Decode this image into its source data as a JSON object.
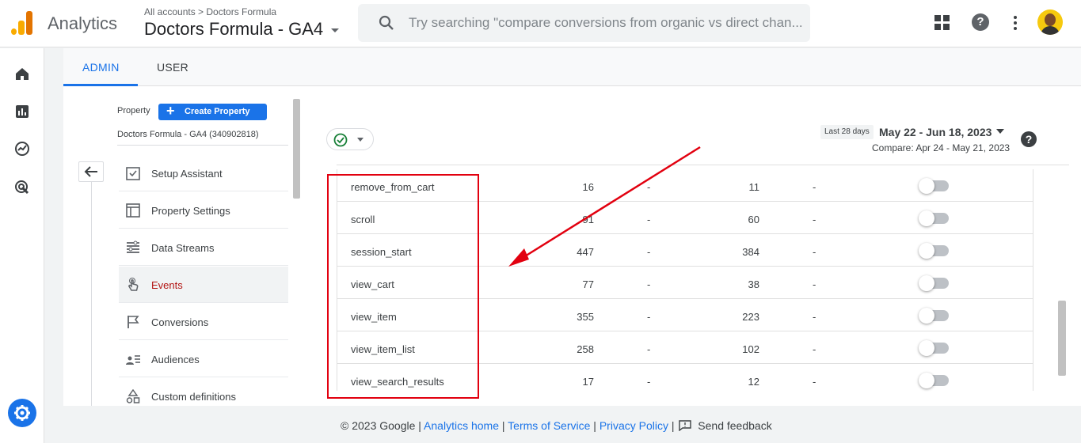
{
  "header": {
    "app_name": "Analytics",
    "breadcrumb": "All accounts > Doctors Formula",
    "property_title": "Doctors Formula - GA4",
    "search_placeholder": "Try searching \"compare conversions from organic vs direct chan..."
  },
  "tabs": [
    {
      "label": "ADMIN",
      "active": true
    },
    {
      "label": "USER",
      "active": false
    }
  ],
  "property_panel": {
    "label": "Property",
    "create_button": "Create Property",
    "property_name": "Doctors Formula - GA4 (340902818)"
  },
  "menu": [
    {
      "label": "Setup Assistant",
      "icon": "checklist-icon"
    },
    {
      "label": "Property Settings",
      "icon": "settings-panel-icon"
    },
    {
      "label": "Data Streams",
      "icon": "data-streams-icon"
    },
    {
      "label": "Events",
      "icon": "touch-icon",
      "active": true
    },
    {
      "label": "Conversions",
      "icon": "flag-icon"
    },
    {
      "label": "Audiences",
      "icon": "audience-icon"
    },
    {
      "label": "Custom definitions",
      "icon": "shapes-icon"
    }
  ],
  "date": {
    "badge": "Last 28 days",
    "range": "May 22 - Jun 18, 2023",
    "compare": "Compare: Apr 24 - May 21, 2023"
  },
  "events": [
    {
      "name": "remove_from_cart",
      "count": "16",
      "change": "-",
      "users": "11",
      "users_change": "-",
      "conversion": false
    },
    {
      "name": "scroll",
      "count": "91",
      "change": "-",
      "users": "60",
      "users_change": "-",
      "conversion": false
    },
    {
      "name": "session_start",
      "count": "447",
      "change": "-",
      "users": "384",
      "users_change": "-",
      "conversion": false
    },
    {
      "name": "view_cart",
      "count": "77",
      "change": "-",
      "users": "38",
      "users_change": "-",
      "conversion": false
    },
    {
      "name": "view_item",
      "count": "355",
      "change": "-",
      "users": "223",
      "users_change": "-",
      "conversion": false
    },
    {
      "name": "view_item_list",
      "count": "258",
      "change": "-",
      "users": "102",
      "users_change": "-",
      "conversion": false
    },
    {
      "name": "view_search_results",
      "count": "17",
      "change": "-",
      "users": "12",
      "users_change": "-",
      "conversion": false
    }
  ],
  "footer": {
    "copyright": "© 2023 Google |",
    "analytics_home": "Analytics home",
    "sep1": "|",
    "terms": "Terms of Service",
    "sep2": "|",
    "privacy": "Privacy Policy",
    "sep3": "|",
    "feedback": "Send feedback"
  },
  "colors": {
    "accent": "#1a73e8",
    "active_menu": "#b31412",
    "annotation": "#e2000f"
  }
}
